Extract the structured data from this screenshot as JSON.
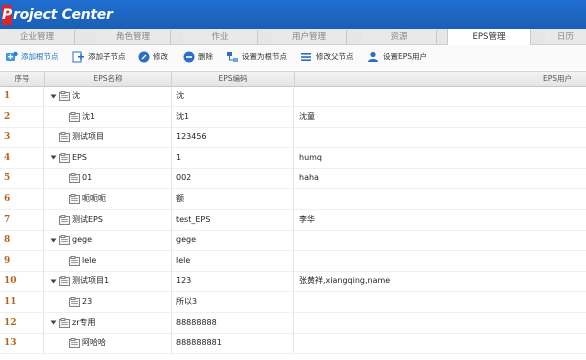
{
  "app": {
    "logo_p": "P",
    "logo_rest": "roject Center"
  },
  "tabs": [
    {
      "label": "企业管理"
    },
    {
      "label": "角色管理"
    },
    {
      "label": "作业"
    },
    {
      "label": "用户管理"
    },
    {
      "label": "资源"
    },
    {
      "label": "EPS管理",
      "active": true
    },
    {
      "label": "日历"
    }
  ],
  "toolbar": {
    "add_root": "添加根节点",
    "add_child": "添加子节点",
    "edit": "修改",
    "delete": "删除",
    "set_root": "设置为根节点",
    "edit_parent": "修改父节点",
    "set_user": "设置EPS用户"
  },
  "grid": {
    "headers": {
      "idx": "序号",
      "name": "EPS名称",
      "code": "EPS编码",
      "user": "EPS用户"
    },
    "rows": [
      {
        "idx": "1",
        "name": "沈",
        "code": "沈",
        "user": "",
        "level": 0,
        "expandable": true
      },
      {
        "idx": "2",
        "name": "沈1",
        "code": "沈1",
        "user": "沈童",
        "level": 1,
        "expandable": false
      },
      {
        "idx": "3",
        "name": "测试项目",
        "code": "123456",
        "user": "",
        "level": 0,
        "expandable": false
      },
      {
        "idx": "4",
        "name": "EPS",
        "code": "1",
        "user": "humq",
        "level": 0,
        "expandable": true
      },
      {
        "idx": "5",
        "name": "01",
        "code": "002",
        "user": "haha",
        "level": 1,
        "expandable": false
      },
      {
        "idx": "6",
        "name": "呃呃呃",
        "code": "额",
        "user": "",
        "level": 1,
        "expandable": false
      },
      {
        "idx": "7",
        "name": "测试EPS",
        "code": "test_EPS",
        "user": "李华",
        "level": 0,
        "expandable": false
      },
      {
        "idx": "8",
        "name": "gege",
        "code": "gege",
        "user": "",
        "level": 0,
        "expandable": true
      },
      {
        "idx": "9",
        "name": "lele",
        "code": "lele",
        "user": "",
        "level": 1,
        "expandable": false
      },
      {
        "idx": "10",
        "name": "测试项目1",
        "code": "123",
        "user": "张黄祥,xiangqing,name",
        "level": 0,
        "expandable": true
      },
      {
        "idx": "11",
        "name": "23",
        "code": "所以3",
        "user": "",
        "level": 1,
        "expandable": false
      },
      {
        "idx": "12",
        "name": "zr专用",
        "code": "88888888",
        "user": "",
        "level": 0,
        "expandable": true
      },
      {
        "idx": "13",
        "name": "阿哈哈",
        "code": "888888881",
        "user": "",
        "level": 1,
        "expandable": false
      }
    ]
  },
  "colors": {
    "header_blue": "#1a5fb6",
    "logo_red": "#d9262c",
    "index_orange": "#b4651b"
  }
}
